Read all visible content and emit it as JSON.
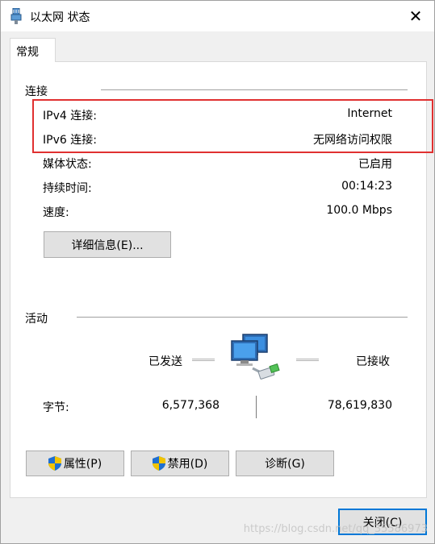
{
  "window": {
    "title": "以太网 状态",
    "close_glyph": "✕"
  },
  "tabs": [
    {
      "label": "常规"
    }
  ],
  "connection": {
    "group_label": "连接",
    "rows": [
      {
        "label": "IPv4 连接:",
        "value": "Internet"
      },
      {
        "label": "IPv6 连接:",
        "value": "无网络访问权限"
      },
      {
        "label": "媒体状态:",
        "value": "已启用"
      },
      {
        "label": "持续时间:",
        "value": "00:14:23"
      },
      {
        "label": "速度:",
        "value": "100.0 Mbps"
      }
    ],
    "details_button": "详细信息(E)..."
  },
  "activity": {
    "group_label": "活动",
    "sent_label": "已发送",
    "received_label": "已接收",
    "bytes_label": "字节:",
    "bytes_sent": "6,577,368",
    "bytes_received": "78,619,830"
  },
  "buttons": {
    "properties": "属性(P)",
    "disable": "禁用(D)",
    "diagnose": "诊断(G)",
    "close": "关闭(C)"
  },
  "watermark": "https://blog.csdn.net/qq_35586973",
  "colors": {
    "highlight": "#e03030",
    "accent": "#0078d7",
    "shield_blue": "#1f6fd1",
    "shield_yellow": "#f2c400"
  },
  "icons": {
    "title": "network-adapter-icon",
    "activity": "network-computers-icon",
    "shield": "uac-shield-icon"
  }
}
